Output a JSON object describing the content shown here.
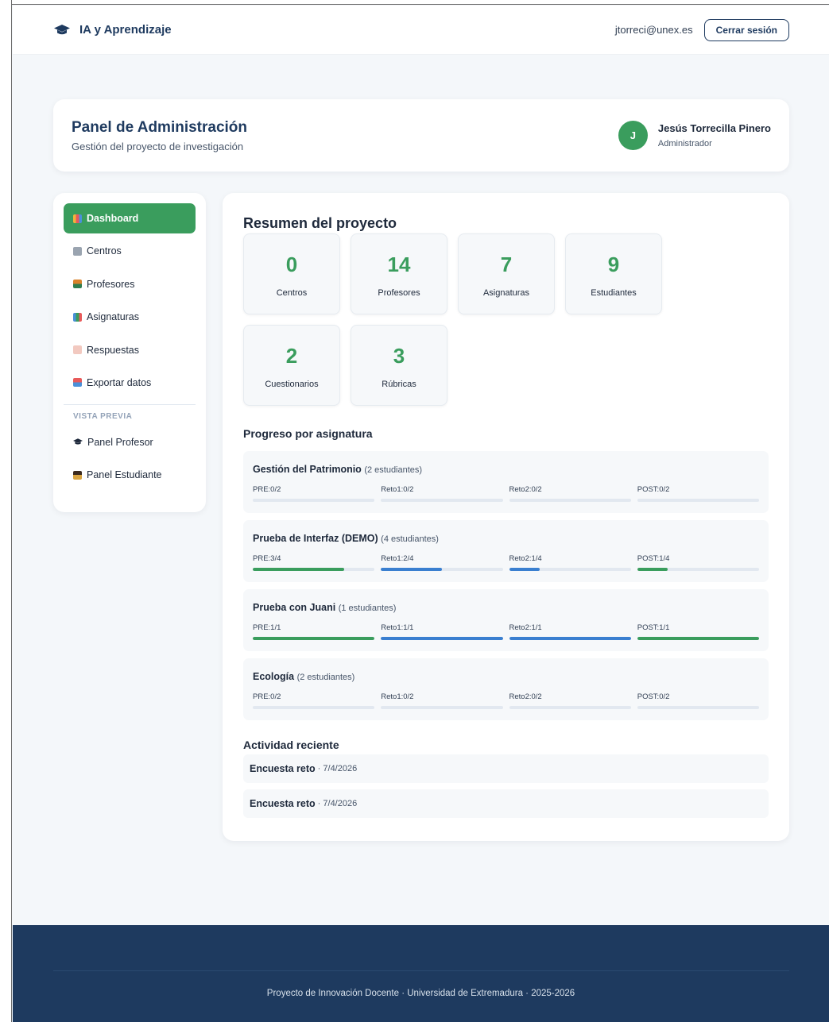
{
  "header": {
    "brand": "IA y Aprendizaje",
    "email": "jtorreci@unex.es",
    "logout_label": "Cerrar sesión"
  },
  "panel": {
    "title": "Panel de Administración",
    "subtitle": "Gestión del proyecto de investigación",
    "user": {
      "initial": "J",
      "name": "Jesús Torrecilla Pinero",
      "role": "Administrador"
    }
  },
  "sidebar": {
    "items": [
      {
        "label": "Dashboard",
        "icon": "bar-chart-icon",
        "active": true
      },
      {
        "label": "Centros",
        "icon": "building-icon"
      },
      {
        "label": "Profesores",
        "icon": "teacher-icon"
      },
      {
        "label": "Asignaturas",
        "icon": "books-icon"
      },
      {
        "label": "Respuestas",
        "icon": "memo-icon"
      },
      {
        "label": "Exportar datos",
        "icon": "download-icon"
      }
    ],
    "preview_label": "VISTA PREVIA",
    "preview_items": [
      {
        "label": "Panel Profesor",
        "icon": "graduation-cap-icon"
      },
      {
        "label": "Panel Estudiante",
        "icon": "student-icon"
      }
    ]
  },
  "main": {
    "summary_title": "Resumen del proyecto",
    "stats": [
      {
        "value": "0",
        "label": "Centros"
      },
      {
        "value": "14",
        "label": "Profesores"
      },
      {
        "value": "7",
        "label": "Asignaturas"
      },
      {
        "value": "9",
        "label": "Estudiantes"
      },
      {
        "value": "2",
        "label": "Cuestionarios"
      },
      {
        "value": "3",
        "label": "Rúbricas"
      }
    ],
    "progress_title": "Progreso por asignatura",
    "subjects": [
      {
        "name": "Gestión del Patrimonio",
        "count": "(2 estudiantes)",
        "phases": [
          {
            "label": "PRE:0/2",
            "done": 0,
            "total": 2
          },
          {
            "label": "Reto1:0/2",
            "done": 0,
            "total": 2
          },
          {
            "label": "Reto2:0/2",
            "done": 0,
            "total": 2
          },
          {
            "label": "POST:0/2",
            "done": 0,
            "total": 2
          }
        ]
      },
      {
        "name": "Prueba de Interfaz (DEMO)",
        "count": "(4 estudiantes)",
        "phases": [
          {
            "label": "PRE:3/4",
            "done": 3,
            "total": 4
          },
          {
            "label": "Reto1:2/4",
            "done": 2,
            "total": 4
          },
          {
            "label": "Reto2:1/4",
            "done": 1,
            "total": 4
          },
          {
            "label": "POST:1/4",
            "done": 1,
            "total": 4
          }
        ]
      },
      {
        "name": "Prueba con Juani",
        "count": "(1 estudiantes)",
        "phases": [
          {
            "label": "PRE:1/1",
            "done": 1,
            "total": 1
          },
          {
            "label": "Reto1:1/1",
            "done": 1,
            "total": 1
          },
          {
            "label": "Reto2:1/1",
            "done": 1,
            "total": 1
          },
          {
            "label": "POST:1/1",
            "done": 1,
            "total": 1
          }
        ]
      },
      {
        "name": "Ecología",
        "count": "(2 estudiantes)",
        "phases": [
          {
            "label": "PRE:0/2",
            "done": 0,
            "total": 2
          },
          {
            "label": "Reto1:0/2",
            "done": 0,
            "total": 2
          },
          {
            "label": "Reto2:0/2",
            "done": 0,
            "total": 2
          },
          {
            "label": "POST:0/2",
            "done": 0,
            "total": 2
          }
        ]
      }
    ],
    "activity_title": "Actividad reciente",
    "activity": [
      {
        "title": "Encuesta reto",
        "date": "· 7/4/2026"
      },
      {
        "title": "Encuesta reto",
        "date": "· 7/4/2026"
      }
    ]
  },
  "footer": {
    "text": "Proyecto de Innovación Docente · Universidad de Extremadura · 2025-2026"
  },
  "colors": {
    "primary_green": "#3a9d5d",
    "progress_blue": "#3a7fd0",
    "navy": "#1e3a5f"
  }
}
